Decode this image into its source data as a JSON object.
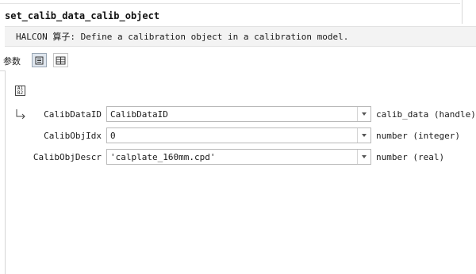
{
  "operator": {
    "name": "set_calib_data_calib_object",
    "description": "HALCON 算子: Define a calibration object in a calibration model."
  },
  "params_panel": {
    "tab_label": "参数"
  },
  "parameters": [
    {
      "name": "CalibDataID",
      "value": "CalibDataID",
      "type": "calib_data (handle)"
    },
    {
      "name": "CalibObjIdx",
      "value": "0",
      "type": "number (integer)"
    },
    {
      "name": "CalibObjDescr",
      "value": "'calplate_160mm.cpd'",
      "type": "number (real)"
    }
  ],
  "icons": {
    "list_view": "list-view-icon",
    "table_view": "table-view-icon",
    "sort": "sort-az-icon",
    "current_row": "arrow-return-icon",
    "dropdown": "chevron-down-icon"
  }
}
